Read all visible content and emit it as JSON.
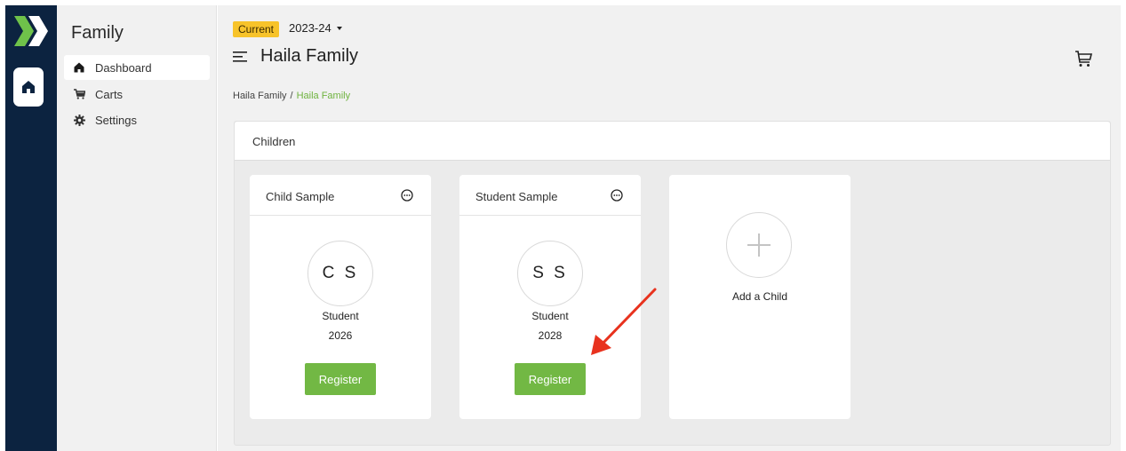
{
  "sidebar": {
    "title": "Family",
    "items": [
      {
        "label": "Dashboard",
        "icon": "home-icon",
        "active": true
      },
      {
        "label": "Carts",
        "icon": "cart-icon",
        "active": false
      },
      {
        "label": "Settings",
        "icon": "gear-icon",
        "active": false
      }
    ]
  },
  "header": {
    "badge": "Current",
    "year": "2023-24",
    "title": "Haila Family"
  },
  "breadcrumb": {
    "parent": "Haila Family",
    "separator": "/",
    "current": "Haila Family"
  },
  "children_panel": {
    "title": "Children",
    "children": [
      {
        "name": "Child Sample",
        "initials": "C S",
        "role": "Student",
        "year": "2026",
        "action": "Register"
      },
      {
        "name": "Student Sample",
        "initials": "S S",
        "role": "Student",
        "year": "2028",
        "action": "Register"
      }
    ],
    "add_label": "Add a Child"
  },
  "colors": {
    "rail": "#0c2340",
    "brand_green": "#72b844",
    "badge_yellow": "#f7c32a",
    "breadcrumb_active": "#6fb33f",
    "annotation_arrow": "#e8321e"
  }
}
